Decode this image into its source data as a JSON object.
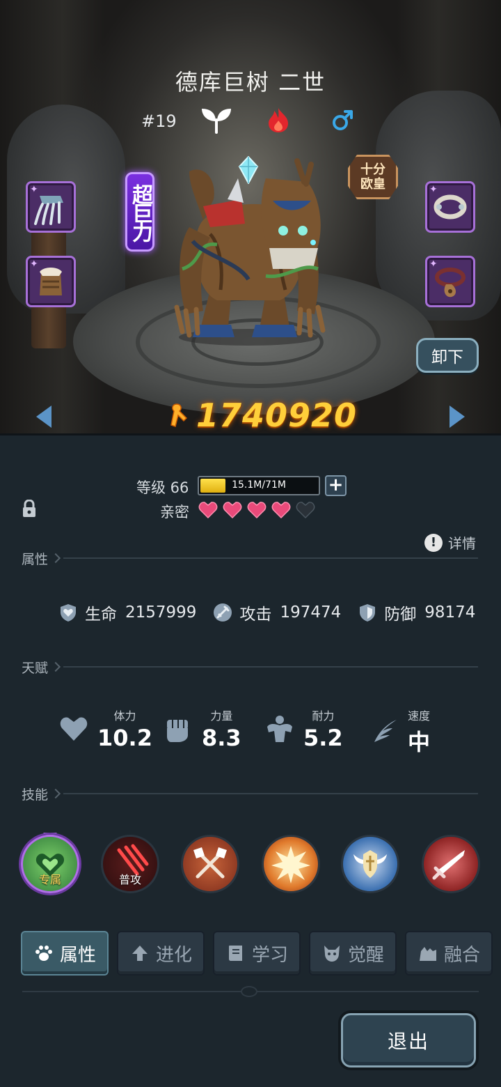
{
  "monster": {
    "name": "德库巨树 二世",
    "number": "#19",
    "type_icon": "leaf-icon",
    "element_icon": "fire-icon",
    "gender_icon": "male-icon",
    "trait_badge": "超巨力",
    "luck_badge": "十分欧皇",
    "power": "1740920"
  },
  "equipment": {
    "slots": [
      "claw-equipment",
      "armor-equipment",
      "collar-equipment",
      "necklace-equipment"
    ],
    "unequip_label": "卸下"
  },
  "level": {
    "label": "等级 66",
    "exp_text": "15.1M/71M",
    "exp_fraction": 0.213
  },
  "intimacy": {
    "label": "亲密",
    "filled": 4,
    "total": 5
  },
  "detail_label": "详情",
  "sections": {
    "attributes": "属性",
    "talent": "天赋",
    "skills": "技能"
  },
  "stats": [
    {
      "icon": "heart-shield-icon",
      "name": "生命",
      "value": "2157999"
    },
    {
      "icon": "sword-icon",
      "name": "攻击",
      "value": "197474"
    },
    {
      "icon": "shield-icon",
      "name": "防御",
      "value": "98174"
    }
  ],
  "talents": [
    {
      "icon": "heart-icon",
      "name": "体力",
      "value": "10.2"
    },
    {
      "icon": "fist-icon",
      "name": "力量",
      "value": "8.3"
    },
    {
      "icon": "muscle-icon",
      "name": "耐力",
      "value": "5.2"
    },
    {
      "icon": "wing-icon",
      "name": "速度",
      "value": "中"
    }
  ],
  "skills": [
    {
      "icon": "exclusive-skill-icon",
      "tag": "专属"
    },
    {
      "icon": "claw-slash-icon",
      "tag": "普攻"
    },
    {
      "icon": "crossed-axes-icon",
      "tag": ""
    },
    {
      "icon": "explosion-icon",
      "tag": ""
    },
    {
      "icon": "winged-shield-icon",
      "tag": ""
    },
    {
      "icon": "sword-strike-icon",
      "tag": ""
    }
  ],
  "tabs": [
    {
      "icon": "paw-icon",
      "label": "属性",
      "active": true
    },
    {
      "icon": "arrow-up-icon",
      "label": "进化",
      "active": false
    },
    {
      "icon": "book-icon",
      "label": "学习",
      "active": false
    },
    {
      "icon": "beast-head-icon",
      "label": "觉醒",
      "active": false
    },
    {
      "icon": "fusion-icon",
      "label": "融合",
      "active": false
    }
  ],
  "exit_label": "退出",
  "colors": {
    "power": "#ffcf3a",
    "exp_fill": "#ffe14d",
    "heart_filled": "#e94a7a",
    "heart_empty": "#2a3138",
    "trait_purple": "#7a2fe0"
  }
}
